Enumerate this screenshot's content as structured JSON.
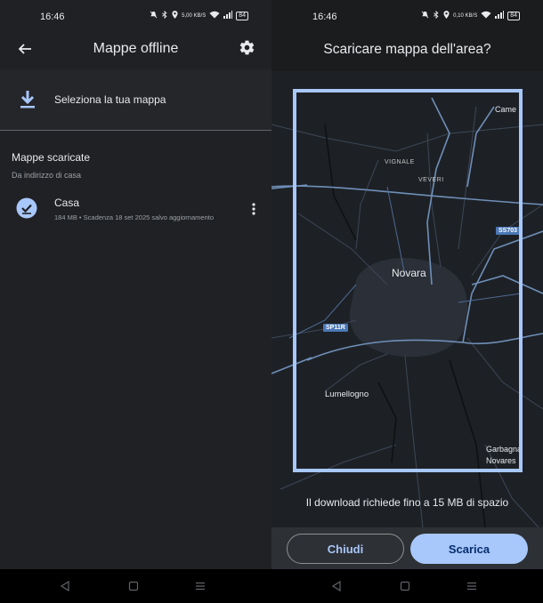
{
  "left": {
    "status": {
      "time": "16:46",
      "net_speed": "5,00 KB/S",
      "battery": "84"
    },
    "header": {
      "title": "Mappe offline"
    },
    "select_map": {
      "label": "Seleziona la tua mappa"
    },
    "downloaded": {
      "title": "Mappe scaricate",
      "subtitle": "Da indirizzo di casa",
      "items": [
        {
          "name": "Casa",
          "meta": "184 MB • Scadenza 18 set 2025 salvo aggiornamento"
        }
      ]
    }
  },
  "right": {
    "status": {
      "time": "16:46",
      "net_speed": "0,10 KB/S",
      "battery": "84"
    },
    "dialog": {
      "title": "Scaricare mappa dell'area?",
      "info": "Il download richiede fino a 15 MB di spazio",
      "cancel_label": "Chiudi",
      "confirm_label": "Scarica"
    },
    "map": {
      "city_label": "Novara",
      "places": [
        "Vignale",
        "Veveri",
        "Lumellogno",
        "Cameri",
        "Garbagna Novarese"
      ],
      "place_lines": [
        "VIGNALE",
        "VEVERI",
        "Lumellogno",
        "Came",
        "Garbagna",
        "Novares"
      ],
      "road_badges": [
        "SS703",
        "SP11R"
      ]
    }
  },
  "icons": {
    "back": "arrow-left-icon",
    "settings": "gear-icon",
    "download": "download-icon",
    "check": "check-circle-icon",
    "more": "more-vert-icon",
    "nav_back": "triangle-back-icon",
    "nav_home": "square-home-icon",
    "nav_recent": "menu-recent-icon"
  },
  "colors": {
    "background": "#202124",
    "accent": "#a8c7fa",
    "map_bg": "#1d2126",
    "road": "#6f8fb8"
  }
}
